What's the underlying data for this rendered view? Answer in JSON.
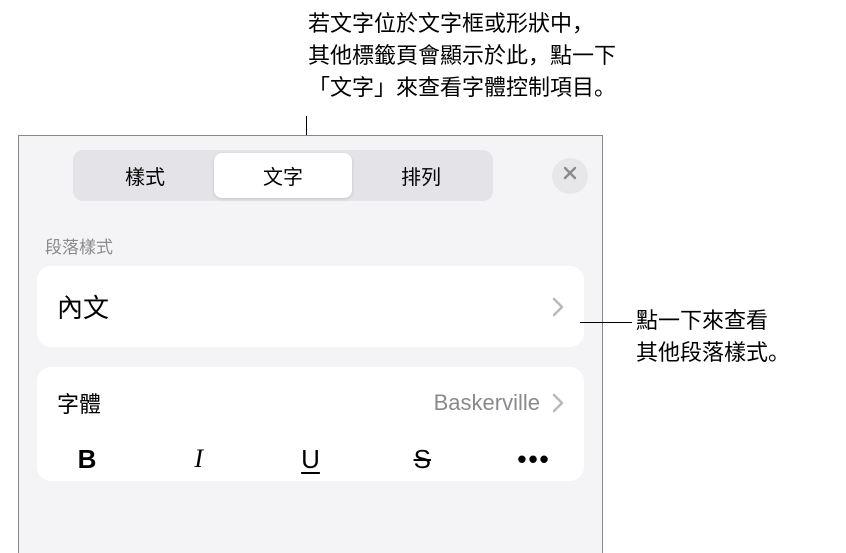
{
  "annotations": {
    "top": "若文字位於文字框或形狀中，\n其他標籤頁會顯示於此，點一下\n「文字」來查看字體控制項目。",
    "right": "點一下來查看\n其他段落樣式。"
  },
  "tabs": {
    "style": "樣式",
    "text": "文字",
    "arrange": "排列"
  },
  "section": {
    "paragraphStyleLabel": "段落樣式",
    "paragraphStyleValue": "內文"
  },
  "font": {
    "label": "字體",
    "value": "Baskerville"
  },
  "styleButtons": {
    "bold": "B",
    "italic": "I",
    "underline": "U",
    "strike": "S",
    "more": "•••"
  }
}
